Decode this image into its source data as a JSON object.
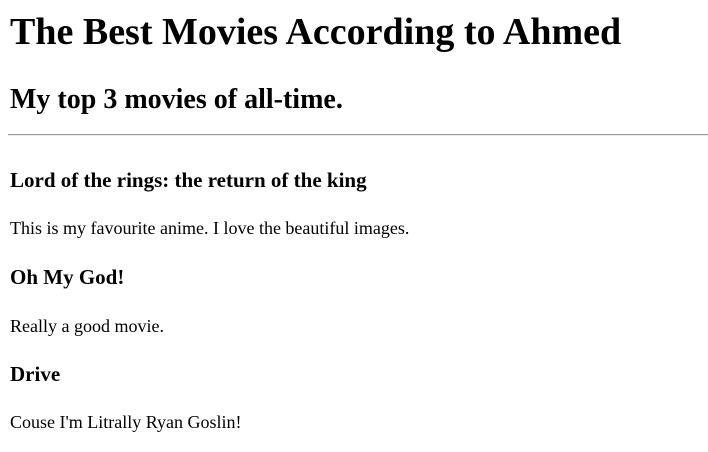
{
  "header": {
    "title": "The Best Movies According to Ahmed",
    "subtitle": "My top 3 movies of all-time."
  },
  "movies": [
    {
      "title": "Lord of the rings: the return of the king",
      "description": "This is my favourite anime. I love the beautiful images."
    },
    {
      "title": "Oh My God!",
      "description": "Really a good movie."
    },
    {
      "title": "Drive",
      "description": "Couse I'm Litrally Ryan Goslin!"
    }
  ]
}
